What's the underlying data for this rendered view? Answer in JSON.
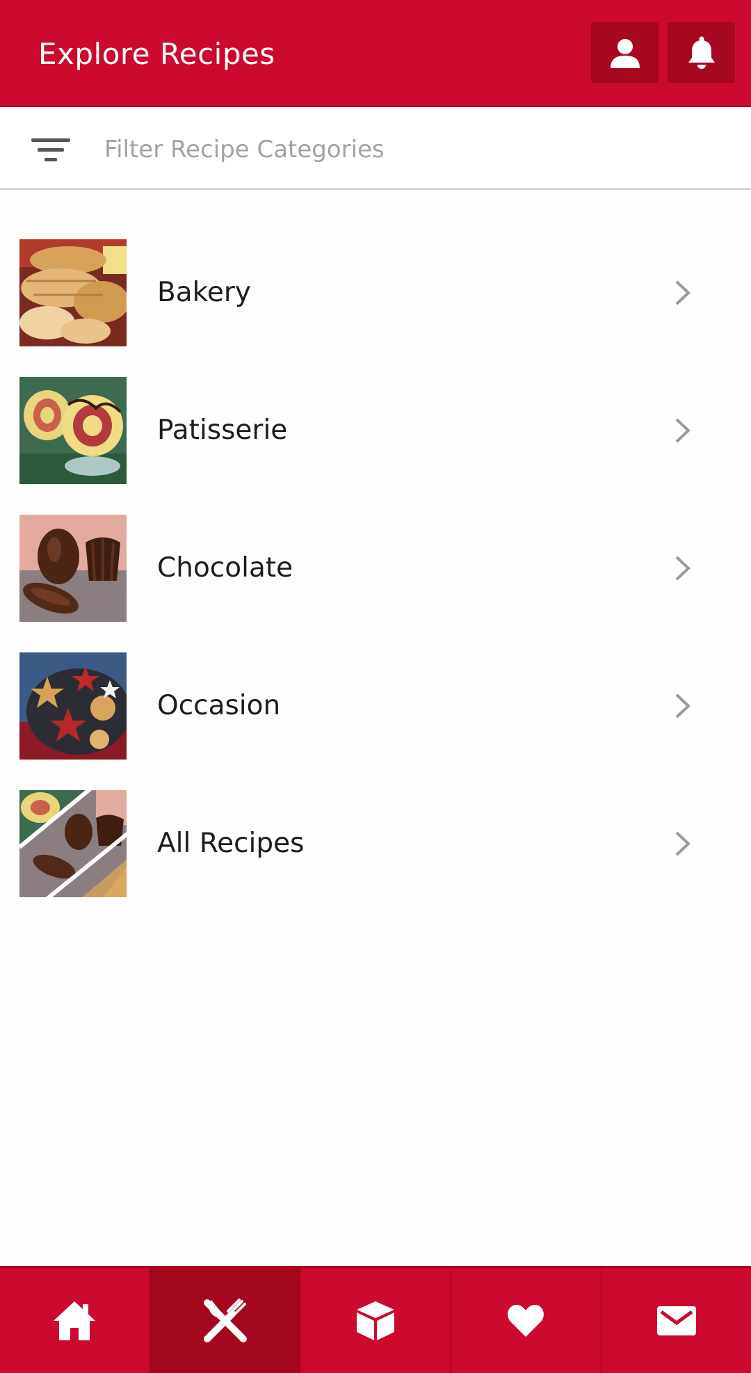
{
  "header": {
    "title": "Explore Recipes",
    "profile_icon": "user-icon",
    "notifications_icon": "bell-icon"
  },
  "filter": {
    "icon": "filter-icon",
    "placeholder": "Filter Recipe Categories",
    "value": ""
  },
  "categories": [
    {
      "label": "Bakery",
      "image": "bread-loaves-photo"
    },
    {
      "label": "Patisserie",
      "image": "swiss-roll-photo"
    },
    {
      "label": "Chocolate",
      "image": "chocolate-pralines-photo"
    },
    {
      "label": "Occasion",
      "image": "christmas-cookies-photo"
    },
    {
      "label": "All Recipes",
      "image": "collage-photo"
    }
  ],
  "bottom_nav": {
    "active": "recipes",
    "items": [
      {
        "id": "home",
        "icon": "home-icon"
      },
      {
        "id": "recipes",
        "icon": "fork-knife-icon"
      },
      {
        "id": "products",
        "icon": "box-icon"
      },
      {
        "id": "favorites",
        "icon": "heart-icon"
      },
      {
        "id": "messages",
        "icon": "envelope-icon"
      }
    ]
  },
  "colors": {
    "brand_red": "#cc0a2e",
    "brand_red_dark": "#a5071f",
    "chevron": "#9a9a9a"
  }
}
